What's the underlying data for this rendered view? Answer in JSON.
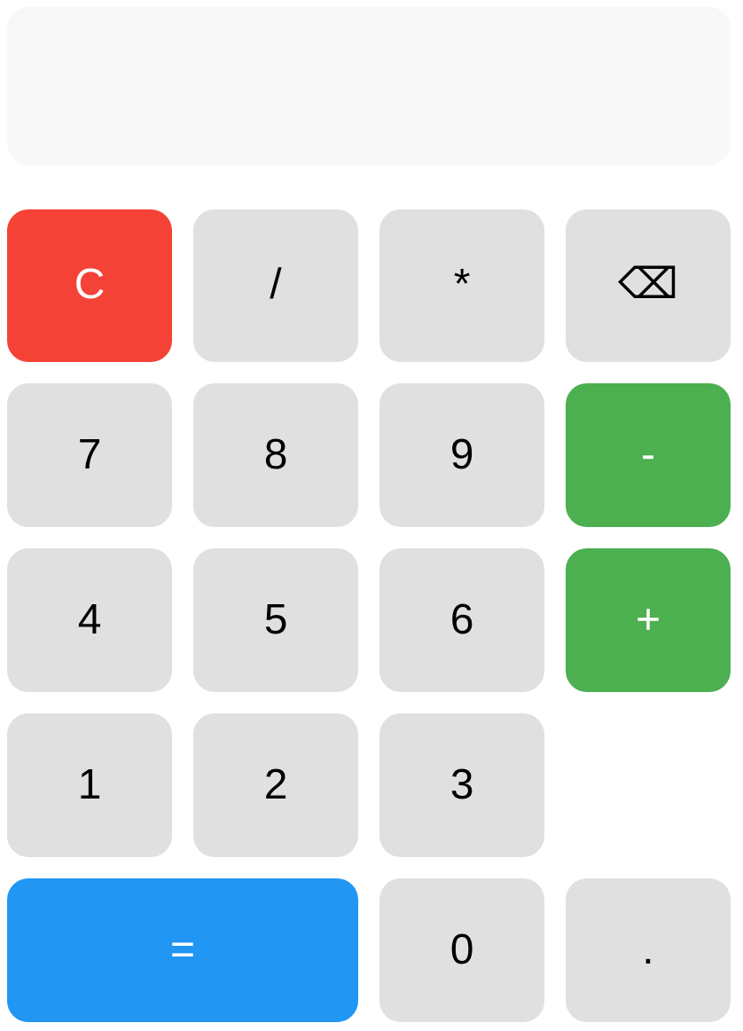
{
  "rows": [
    [
      {
        "label": "C",
        "kind": "clear"
      },
      {
        "label": "/",
        "kind": "key"
      },
      {
        "label": "*",
        "kind": "key"
      },
      {
        "label": "⌫",
        "kind": "key"
      }
    ],
    [
      {
        "label": "7",
        "kind": "key"
      },
      {
        "label": "8",
        "kind": "key"
      },
      {
        "label": "9",
        "kind": "key"
      },
      {
        "label": "-",
        "kind": "operator"
      }
    ],
    [
      {
        "label": "4",
        "kind": "key"
      },
      {
        "label": "5",
        "kind": "key"
      },
      {
        "label": "6",
        "kind": "key"
      },
      {
        "label": "+",
        "kind": "operator"
      }
    ],
    [
      {
        "label": "1",
        "kind": "key"
      },
      {
        "label": "2",
        "kind": "key"
      },
      {
        "label": "3",
        "kind": "key"
      }
    ],
    [
      {
        "label": "=",
        "kind": "equals"
      },
      {
        "label": "0",
        "kind": "key"
      },
      {
        "label": ".",
        "kind": "key"
      }
    ]
  ]
}
